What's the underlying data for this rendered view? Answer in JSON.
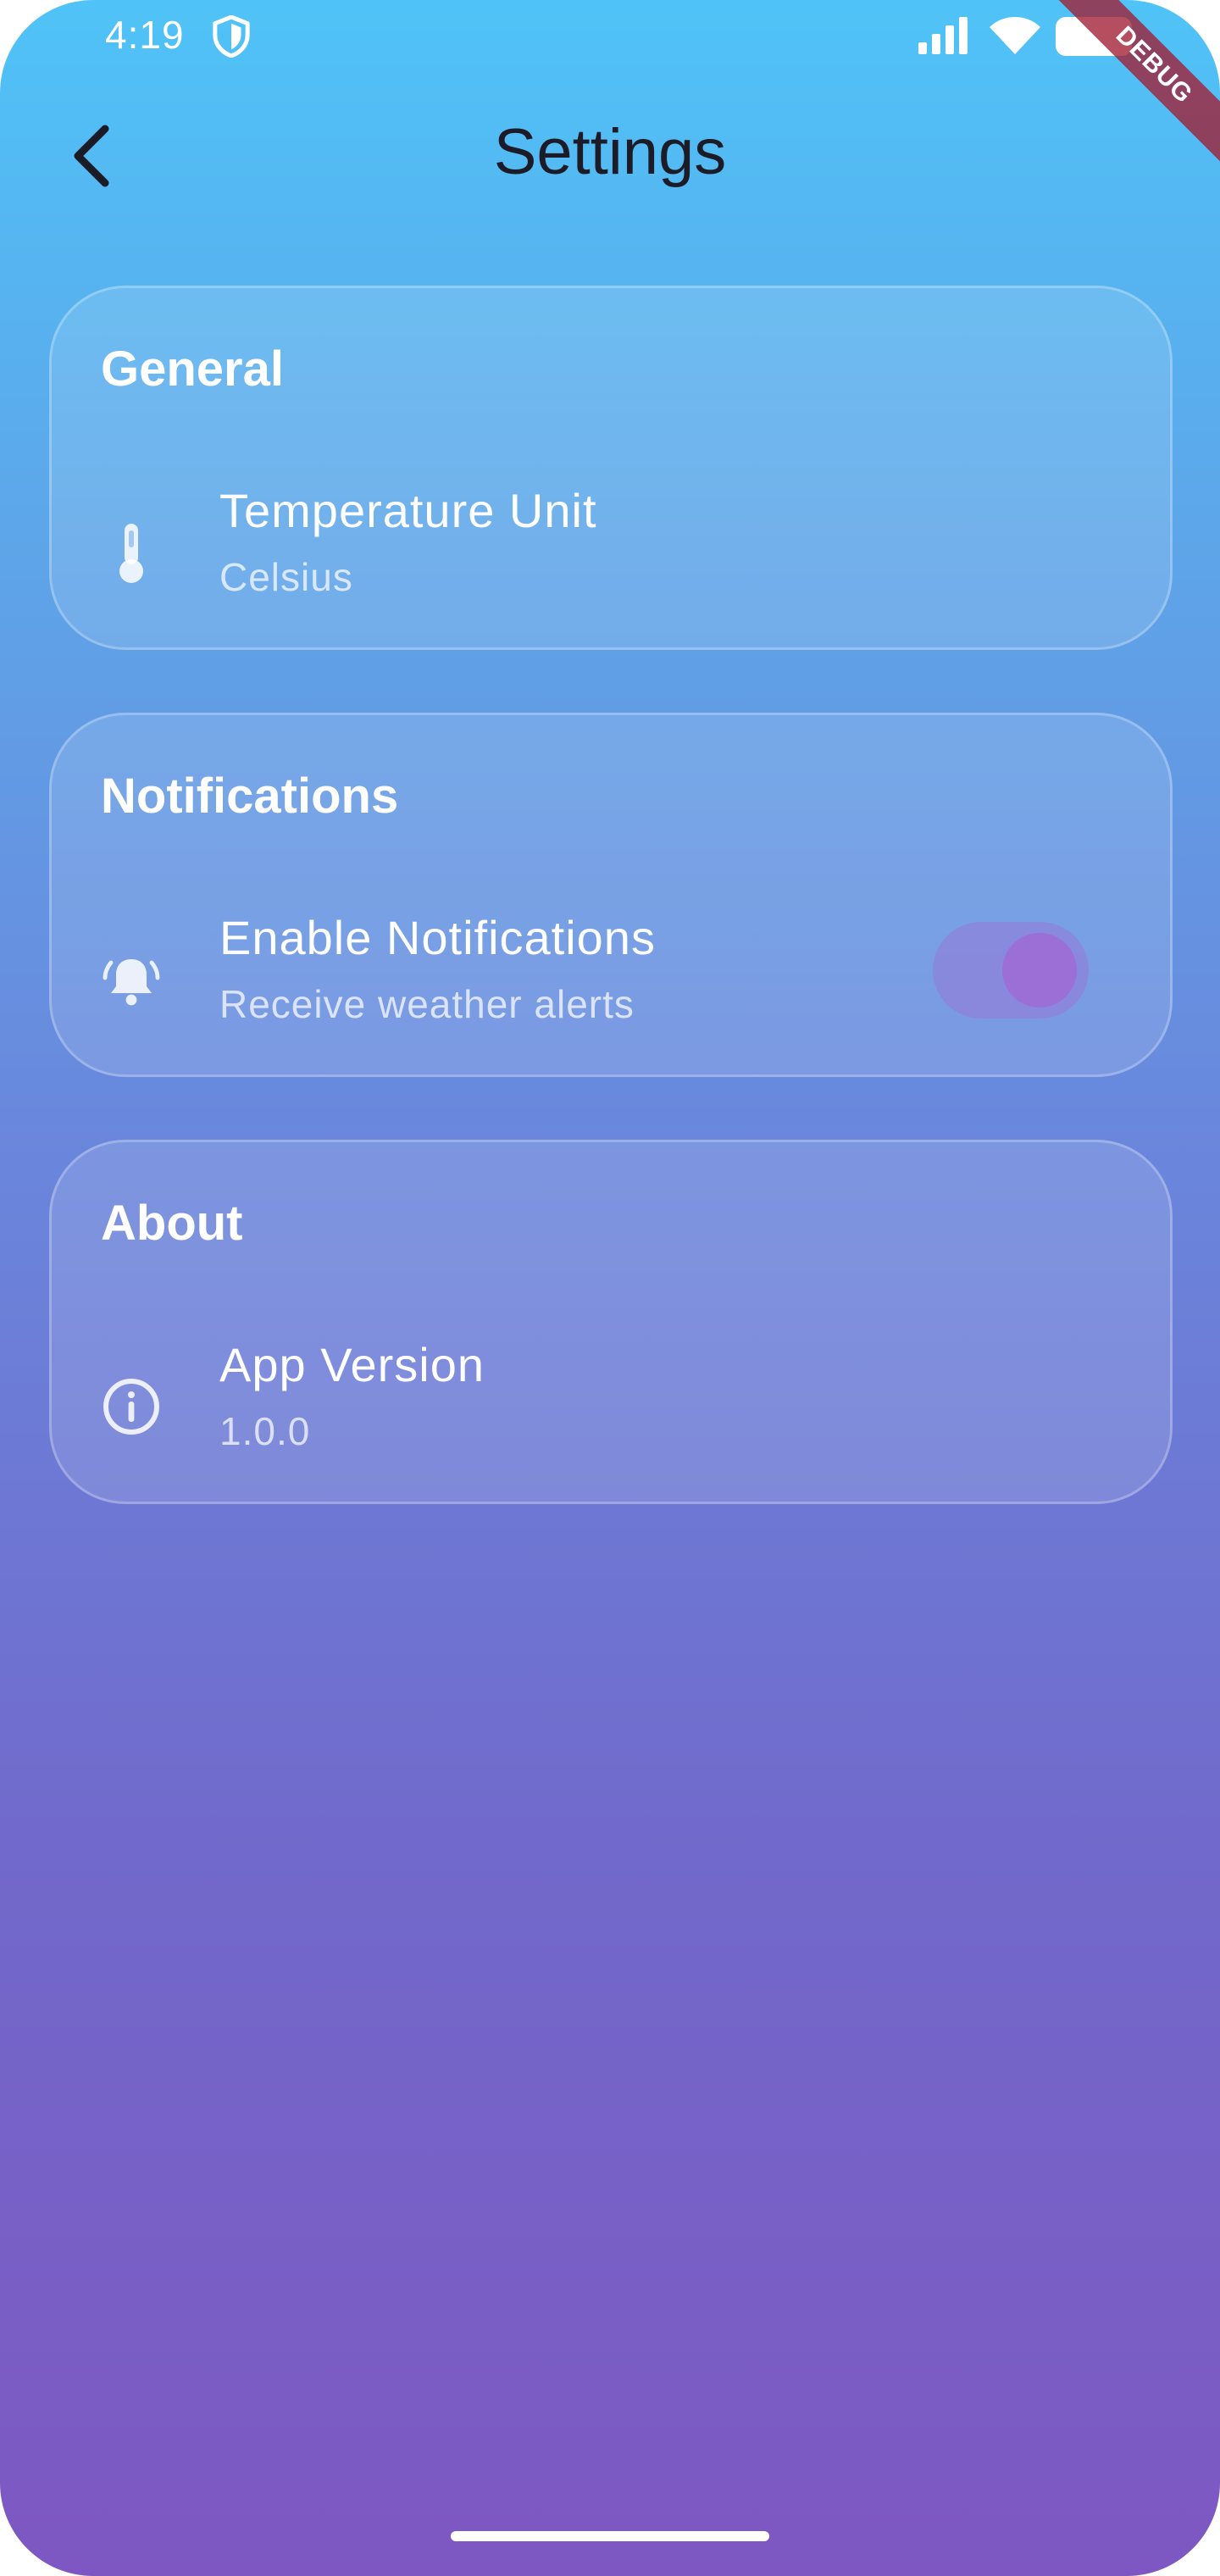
{
  "status_bar": {
    "time": "4:19",
    "icons": [
      "shield-icon",
      "signal-icon",
      "wifi-icon",
      "battery-icon"
    ]
  },
  "debug_banner": {
    "label": "DEBUG"
  },
  "app_bar": {
    "back_icon": "chevron-left-icon",
    "title": "Settings"
  },
  "sections": {
    "general": {
      "title": "General",
      "item": {
        "icon": "thermometer-icon",
        "title": "Temperature Unit",
        "subtitle": "Celsius"
      }
    },
    "notifications": {
      "title": "Notifications",
      "item": {
        "icon": "bell-ringing-icon",
        "title": "Enable Notifications",
        "subtitle": "Receive weather alerts",
        "toggle_on": true
      }
    },
    "about": {
      "title": "About",
      "item": {
        "icon": "info-icon",
        "title": "App Version",
        "subtitle": "1.0.0"
      }
    }
  },
  "colors": {
    "gradient_top": "#4fc3f7",
    "gradient_bottom": "#7e57c2",
    "toggle_thumb": "#9c6fd6",
    "title_text": "#1c1c28"
  }
}
